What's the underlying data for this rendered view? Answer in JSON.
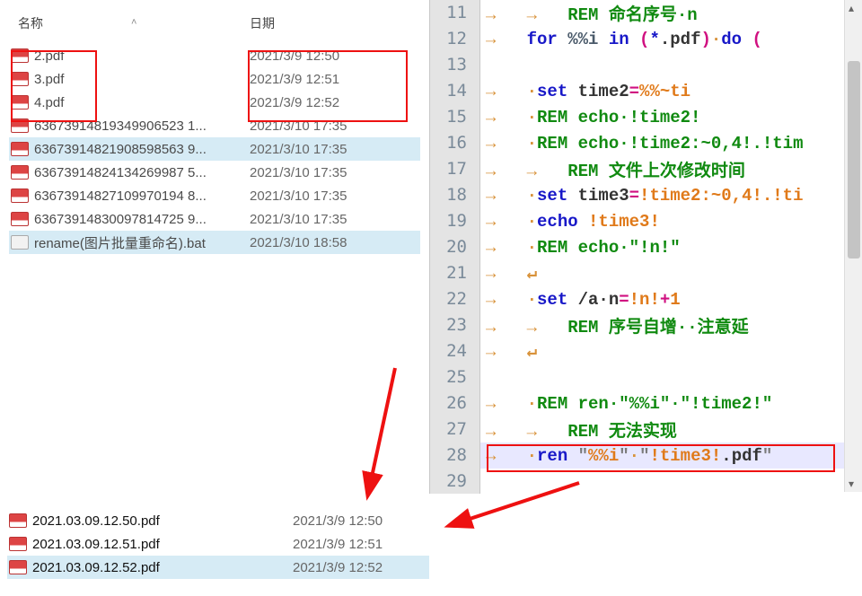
{
  "left_panel": {
    "header_name": "名称",
    "header_date": "日期",
    "sort_caret": "˄",
    "files": [
      {
        "name": "2.pdf",
        "date": "2021/3/9 12:50",
        "icon": "pdf",
        "selected": false
      },
      {
        "name": "3.pdf",
        "date": "2021/3/9 12:51",
        "icon": "pdf",
        "selected": false
      },
      {
        "name": "4.pdf",
        "date": "2021/3/9 12:52",
        "icon": "pdf",
        "selected": false
      },
      {
        "name": "63673914819349906523 1...",
        "date": "2021/3/10 17:35",
        "icon": "pdf",
        "selected": false
      },
      {
        "name": "63673914821908598563 9...",
        "date": "2021/3/10 17:35",
        "icon": "pdf",
        "selected": true
      },
      {
        "name": "63673914824134269987 5...",
        "date": "2021/3/10 17:35",
        "icon": "pdf",
        "selected": false
      },
      {
        "name": "63673914827109970194 8...",
        "date": "2021/3/10 17:35",
        "icon": "pdf",
        "selected": false
      },
      {
        "name": "63673914830097814725 9...",
        "date": "2021/3/10 17:35",
        "icon": "pdf",
        "selected": false
      },
      {
        "name": "rename(图片批量重命名).bat",
        "date": "2021/3/10 18:58",
        "icon": "bat",
        "selected": true
      }
    ]
  },
  "renamed": [
    {
      "name": "2021.03.09.12.50.pdf",
      "date": "2021/3/9 12:50",
      "selected": false
    },
    {
      "name": "2021.03.09.12.51.pdf",
      "date": "2021/3/9 12:51",
      "selected": false
    },
    {
      "name": "2021.03.09.12.52.pdf",
      "date": "2021/3/9 12:52",
      "selected": true
    }
  ],
  "code": {
    "lines": [
      {
        "n": "11",
        "tokens": [
          {
            "t": "→   →   ",
            "c": "ws"
          },
          {
            "t": "REM ",
            "c": "cm"
          },
          {
            "t": "命名序号·n",
            "c": "cm"
          }
        ]
      },
      {
        "n": "12",
        "tokens": [
          {
            "t": "→   ",
            "c": "ws"
          },
          {
            "t": "for ",
            "c": "kw"
          },
          {
            "t": "%%i ",
            "c": "var"
          },
          {
            "t": "in ",
            "c": "kw"
          },
          {
            "t": "(",
            "c": "op"
          },
          {
            "t": "*",
            "c": "kw"
          },
          {
            "t": ".pdf",
            "c": "plain"
          },
          {
            "t": ")",
            "c": "op"
          },
          {
            "t": "·",
            "c": "ws"
          },
          {
            "t": "do ",
            "c": "kw"
          },
          {
            "t": "(",
            "c": "op"
          }
        ]
      },
      {
        "n": "13",
        "tokens": [
          {
            "t": " ",
            "c": "plain"
          }
        ]
      },
      {
        "n": "14",
        "tokens": [
          {
            "t": "→   ",
            "c": "ws"
          },
          {
            "t": "·",
            "c": "ws"
          },
          {
            "t": "set ",
            "c": "kw"
          },
          {
            "t": "time2",
            "c": "plain"
          },
          {
            "t": "=",
            "c": "op"
          },
          {
            "t": "%%~ti",
            "c": "num"
          }
        ]
      },
      {
        "n": "15",
        "tokens": [
          {
            "t": "→   ",
            "c": "ws"
          },
          {
            "t": "·",
            "c": "ws"
          },
          {
            "t": "REM ",
            "c": "cm"
          },
          {
            "t": "echo·!time2!",
            "c": "cm"
          }
        ]
      },
      {
        "n": "16",
        "tokens": [
          {
            "t": "→   ",
            "c": "ws"
          },
          {
            "t": "·",
            "c": "ws"
          },
          {
            "t": "REM ",
            "c": "cm"
          },
          {
            "t": "echo·!time2:~0,4!.!tim",
            "c": "cm"
          }
        ]
      },
      {
        "n": "17",
        "tokens": [
          {
            "t": "→   →   ",
            "c": "ws"
          },
          {
            "t": "REM ",
            "c": "cm"
          },
          {
            "t": "文件上次修改时间",
            "c": "cm"
          }
        ]
      },
      {
        "n": "18",
        "tokens": [
          {
            "t": "→   ",
            "c": "ws"
          },
          {
            "t": "·",
            "c": "ws"
          },
          {
            "t": "set ",
            "c": "kw"
          },
          {
            "t": "time3",
            "c": "plain"
          },
          {
            "t": "=",
            "c": "op"
          },
          {
            "t": "!time2:~0,4!.!ti",
            "c": "num"
          }
        ]
      },
      {
        "n": "19",
        "tokens": [
          {
            "t": "→   ",
            "c": "ws"
          },
          {
            "t": "·",
            "c": "ws"
          },
          {
            "t": "echo ",
            "c": "kw"
          },
          {
            "t": "!time3!",
            "c": "num"
          }
        ]
      },
      {
        "n": "20",
        "tokens": [
          {
            "t": "→   ",
            "c": "ws"
          },
          {
            "t": "·",
            "c": "ws"
          },
          {
            "t": "REM ",
            "c": "cm"
          },
          {
            "t": "echo·\"!n!\"",
            "c": "cm"
          }
        ]
      },
      {
        "n": "21",
        "tokens": [
          {
            "t": "→   ",
            "c": "ws"
          },
          {
            "t": "↵",
            "c": "ws"
          }
        ]
      },
      {
        "n": "22",
        "tokens": [
          {
            "t": "→   ",
            "c": "ws"
          },
          {
            "t": "·",
            "c": "ws"
          },
          {
            "t": "set ",
            "c": "kw"
          },
          {
            "t": "/a·n",
            "c": "plain"
          },
          {
            "t": "=",
            "c": "op"
          },
          {
            "t": "!n!",
            "c": "num"
          },
          {
            "t": "+",
            "c": "op"
          },
          {
            "t": "1",
            "c": "num"
          }
        ]
      },
      {
        "n": "23",
        "tokens": [
          {
            "t": "→   →   ",
            "c": "ws"
          },
          {
            "t": "REM ",
            "c": "cm"
          },
          {
            "t": "序号自增··注意延",
            "c": "cm"
          }
        ]
      },
      {
        "n": "24",
        "tokens": [
          {
            "t": "→   ",
            "c": "ws"
          },
          {
            "t": "↵",
            "c": "ws"
          }
        ]
      },
      {
        "n": "25",
        "tokens": [
          {
            "t": " ",
            "c": "plain"
          }
        ]
      },
      {
        "n": "26",
        "tokens": [
          {
            "t": "→   ",
            "c": "ws"
          },
          {
            "t": "·",
            "c": "ws"
          },
          {
            "t": "REM ",
            "c": "cm"
          },
          {
            "t": "ren·\"%%i\"·\"!time2!\"",
            "c": "cm"
          }
        ]
      },
      {
        "n": "27",
        "tokens": [
          {
            "t": "→   →   ",
            "c": "ws"
          },
          {
            "t": "REM ",
            "c": "cm"
          },
          {
            "t": "无法实现",
            "c": "cm"
          }
        ]
      },
      {
        "n": "28",
        "current": true,
        "tokens": [
          {
            "t": "→   ",
            "c": "ws"
          },
          {
            "t": "·",
            "c": "ws"
          },
          {
            "t": "ren ",
            "c": "kw"
          },
          {
            "t": "\"",
            "c": "str"
          },
          {
            "t": "%%i",
            "c": "num"
          },
          {
            "t": "\"",
            "c": "str"
          },
          {
            "t": "·",
            "c": "ws"
          },
          {
            "t": "\"",
            "c": "str"
          },
          {
            "t": "!time3!",
            "c": "num"
          },
          {
            "t": ".pdf",
            "c": "plain"
          },
          {
            "t": "\"",
            "c": "str"
          }
        ]
      },
      {
        "n": "29",
        "tokens": [
          {
            "t": " ",
            "c": "plain"
          }
        ]
      }
    ]
  }
}
